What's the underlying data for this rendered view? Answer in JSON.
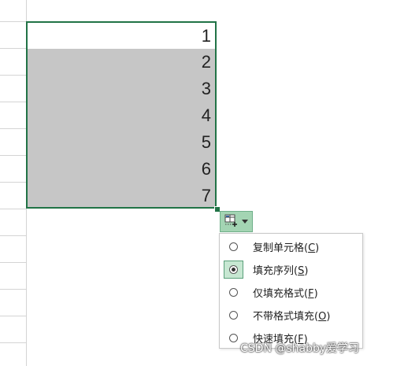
{
  "cells": [
    "1",
    "2",
    "3",
    "4",
    "5",
    "6",
    "7"
  ],
  "autofill_menu": {
    "items": [
      {
        "label": "复制单元格(",
        "key": "C",
        "close": ")",
        "selected": false
      },
      {
        "label": "填充序列(",
        "key": "S",
        "close": ")",
        "selected": true
      },
      {
        "label": "仅填充格式(",
        "key": "F",
        "close": ")",
        "selected": false
      },
      {
        "label": "不带格式填充(",
        "key": "O",
        "close": ")",
        "selected": false
      },
      {
        "label": "快速填充(",
        "key": "F",
        "close": ")",
        "selected": false
      }
    ]
  },
  "watermark": "CSDN @shabby爱学习",
  "colors": {
    "selection_border": "#217346",
    "fill_gray": "#c6c6c6",
    "autofill_button": "#a3d4b3"
  },
  "icons": {
    "autofill_options": "autofill-options-icon",
    "dropdown": "caret-down-icon",
    "radio": "radio-icon"
  }
}
